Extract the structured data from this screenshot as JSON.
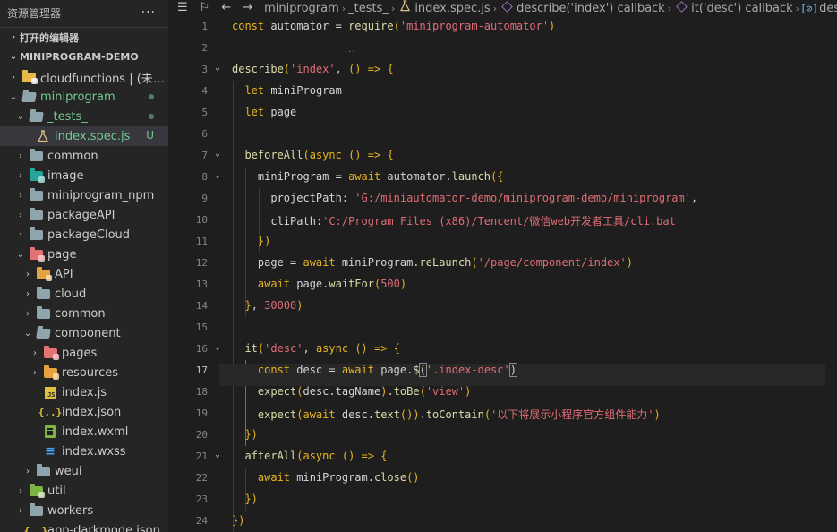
{
  "sidebar": {
    "title": "资源管理器",
    "more": "···",
    "open_editors": "打开的编辑器",
    "project": "MINIPROGRAM-DEMO",
    "tree": [
      {
        "label": "cloudfunctions | (未选...",
        "depth": 1,
        "chevron": "›",
        "icon": "folder-cloud",
        "color": "yellow-folder",
        "status": ""
      },
      {
        "label": "miniprogram",
        "depth": 1,
        "chevron": "⌄",
        "icon": "folder-open",
        "color": "green-label",
        "status": "dot"
      },
      {
        "label": "_tests_",
        "depth": 2,
        "chevron": "⌄",
        "icon": "folder-open",
        "color": "green-label",
        "status": "dot"
      },
      {
        "label": "index.spec.js",
        "depth": 3,
        "chevron": "",
        "icon": "flask",
        "color": "green-label",
        "status": "U",
        "selected": true
      },
      {
        "label": "common",
        "depth": 2,
        "chevron": "›",
        "icon": "folder",
        "color": "",
        "status": ""
      },
      {
        "label": "image",
        "depth": 2,
        "chevron": "›",
        "icon": "folder-image",
        "color": "",
        "status": ""
      },
      {
        "label": "miniprogram_npm",
        "depth": 2,
        "chevron": "›",
        "icon": "folder",
        "color": "",
        "status": ""
      },
      {
        "label": "packageAPI",
        "depth": 2,
        "chevron": "›",
        "icon": "folder",
        "color": "",
        "status": ""
      },
      {
        "label": "packageCloud",
        "depth": 2,
        "chevron": "›",
        "icon": "folder",
        "color": "",
        "status": ""
      },
      {
        "label": "page",
        "depth": 2,
        "chevron": "⌄",
        "icon": "folder-page",
        "color": "",
        "status": ""
      },
      {
        "label": "API",
        "depth": 3,
        "chevron": "›",
        "icon": "folder-api",
        "color": "",
        "status": ""
      },
      {
        "label": "cloud",
        "depth": 3,
        "chevron": "›",
        "icon": "folder",
        "color": "",
        "status": ""
      },
      {
        "label": "common",
        "depth": 3,
        "chevron": "›",
        "icon": "folder",
        "color": "",
        "status": ""
      },
      {
        "label": "component",
        "depth": 3,
        "chevron": "⌄",
        "icon": "folder-open",
        "color": "",
        "status": ""
      },
      {
        "label": "pages",
        "depth": 4,
        "chevron": "›",
        "icon": "folder-page",
        "color": "",
        "status": ""
      },
      {
        "label": "resources",
        "depth": 4,
        "chevron": "›",
        "icon": "folder-resources",
        "color": "",
        "status": ""
      },
      {
        "label": "index.js",
        "depth": 4,
        "chevron": "",
        "icon": "js",
        "color": "",
        "status": ""
      },
      {
        "label": "index.json",
        "depth": 4,
        "chevron": "",
        "icon": "json",
        "color": "",
        "status": ""
      },
      {
        "label": "index.wxml",
        "depth": 4,
        "chevron": "",
        "icon": "wxml",
        "color": "",
        "status": ""
      },
      {
        "label": "index.wxss",
        "depth": 4,
        "chevron": "",
        "icon": "wxss",
        "color": "",
        "status": ""
      },
      {
        "label": "weui",
        "depth": 3,
        "chevron": "›",
        "icon": "folder",
        "color": "",
        "status": ""
      },
      {
        "label": "util",
        "depth": 2,
        "chevron": "›",
        "icon": "folder-util",
        "color": "",
        "status": ""
      },
      {
        "label": "workers",
        "depth": 2,
        "chevron": "›",
        "icon": "folder",
        "color": "",
        "status": ""
      },
      {
        "label": "app-darkmode.json",
        "depth": 2,
        "chevron": "",
        "icon": "json",
        "color": "",
        "status": ""
      }
    ]
  },
  "breadcrumb": {
    "items": [
      {
        "label": "miniprogram",
        "icon": ""
      },
      {
        "label": "_tests_",
        "icon": ""
      },
      {
        "label": "index.spec.js",
        "icon": "flask"
      },
      {
        "label": "describe('index') callback",
        "icon": "cube"
      },
      {
        "label": "it('desc') callback",
        "icon": "cube"
      },
      {
        "label": "desc",
        "icon": "variable"
      }
    ]
  },
  "editor": {
    "current_line": 17,
    "lines": [
      {
        "n": "1",
        "fold": "",
        "tokens": [
          [
            "kw",
            "const"
          ],
          [
            "var",
            " automator "
          ],
          [
            "op",
            "= "
          ],
          [
            "fn",
            "require"
          ],
          [
            "pn",
            "("
          ],
          [
            "str",
            "'miniprogram-automator'"
          ],
          [
            "pn",
            ")"
          ]
        ]
      },
      {
        "n": "2",
        "fold": "",
        "tokens": []
      },
      {
        "n": "3",
        "fold": "⌄",
        "tokens": [
          [
            "fn",
            "describe"
          ],
          [
            "pn",
            "("
          ],
          [
            "str",
            "'index'"
          ],
          [
            "op",
            ", "
          ],
          [
            "pn",
            "() "
          ],
          [
            "kw",
            "=>"
          ],
          [
            "op",
            " "
          ],
          [
            "pn",
            "{"
          ]
        ]
      },
      {
        "n": "4",
        "fold": "",
        "tokens": [
          [
            "op",
            "  "
          ],
          [
            "kw",
            "let"
          ],
          [
            "var",
            " miniProgram"
          ]
        ]
      },
      {
        "n": "5",
        "fold": "",
        "tokens": [
          [
            "op",
            "  "
          ],
          [
            "kw",
            "let"
          ],
          [
            "var",
            " page"
          ]
        ]
      },
      {
        "n": "6",
        "fold": "",
        "tokens": []
      },
      {
        "n": "7",
        "fold": "⌄",
        "tokens": [
          [
            "op",
            "  "
          ],
          [
            "fn",
            "beforeAll"
          ],
          [
            "pn",
            "("
          ],
          [
            "kw",
            "async"
          ],
          [
            "op",
            " "
          ],
          [
            "pn",
            "() "
          ],
          [
            "kw",
            "=>"
          ],
          [
            "op",
            " "
          ],
          [
            "pn",
            "{"
          ]
        ]
      },
      {
        "n": "8",
        "fold": "⌄",
        "tokens": [
          [
            "op",
            "    "
          ],
          [
            "var",
            "miniProgram "
          ],
          [
            "op",
            "= "
          ],
          [
            "kw",
            "await"
          ],
          [
            "var",
            " automator."
          ],
          [
            "fn",
            "launch"
          ],
          [
            "pn",
            "({"
          ]
        ]
      },
      {
        "n": "9",
        "fold": "",
        "tokens": [
          [
            "op",
            "      "
          ],
          [
            "pr",
            "projectPath"
          ],
          [
            "op",
            ": "
          ],
          [
            "str",
            "'G:/miniautomator-demo/miniprogram-demo/miniprogram'"
          ],
          [
            "op",
            ","
          ]
        ]
      },
      {
        "n": "10",
        "fold": "",
        "tokens": [
          [
            "op",
            "      "
          ],
          [
            "pr",
            "cliPath"
          ],
          [
            "op",
            ":"
          ],
          [
            "str",
            "'C:/Program Files (x86)/Tencent/微信web开发者工具/cli.bat'"
          ]
        ]
      },
      {
        "n": "11",
        "fold": "",
        "tokens": [
          [
            "op",
            "    "
          ],
          [
            "pn",
            "})"
          ]
        ]
      },
      {
        "n": "12",
        "fold": "",
        "tokens": [
          [
            "op",
            "    "
          ],
          [
            "var",
            "page "
          ],
          [
            "op",
            "= "
          ],
          [
            "kw",
            "await"
          ],
          [
            "var",
            " miniProgram."
          ],
          [
            "fn",
            "reLaunch"
          ],
          [
            "pn",
            "("
          ],
          [
            "str",
            "'/page/component/index'"
          ],
          [
            "pn",
            ")"
          ]
        ]
      },
      {
        "n": "13",
        "fold": "",
        "tokens": [
          [
            "op",
            "    "
          ],
          [
            "kw",
            "await"
          ],
          [
            "var",
            " page."
          ],
          [
            "fn",
            "waitFor"
          ],
          [
            "pn",
            "("
          ],
          [
            "num",
            "500"
          ],
          [
            "pn",
            ")"
          ]
        ]
      },
      {
        "n": "14",
        "fold": "",
        "tokens": [
          [
            "op",
            "  "
          ],
          [
            "pn",
            "}"
          ],
          [
            "op",
            ", "
          ],
          [
            "num",
            "30000"
          ],
          [
            "pn",
            ")"
          ]
        ]
      },
      {
        "n": "15",
        "fold": "",
        "tokens": []
      },
      {
        "n": "16",
        "fold": "⌄",
        "tokens": [
          [
            "op",
            "  "
          ],
          [
            "fn",
            "it"
          ],
          [
            "pn",
            "("
          ],
          [
            "str",
            "'desc'"
          ],
          [
            "op",
            ", "
          ],
          [
            "kw",
            "async"
          ],
          [
            "op",
            " "
          ],
          [
            "pn",
            "() "
          ],
          [
            "kw",
            "=>"
          ],
          [
            "op",
            " "
          ],
          [
            "pn",
            "{"
          ]
        ]
      },
      {
        "n": "17",
        "fold": "",
        "tokens": [
          [
            "op",
            "    "
          ],
          [
            "kw",
            "const"
          ],
          [
            "var",
            " desc "
          ],
          [
            "op",
            "= "
          ],
          [
            "kw",
            "await"
          ],
          [
            "var",
            " page."
          ],
          [
            "fn",
            "$"
          ],
          [
            "bm",
            "("
          ],
          [
            "str",
            "'.index-desc'"
          ],
          [
            "bm",
            ")"
          ]
        ]
      },
      {
        "n": "18",
        "fold": "",
        "tokens": [
          [
            "op",
            "    "
          ],
          [
            "fn",
            "expect"
          ],
          [
            "pn",
            "("
          ],
          [
            "var",
            "desc.tagName"
          ],
          [
            "pn",
            ")"
          ],
          [
            "var",
            "."
          ],
          [
            "fn",
            "toBe"
          ],
          [
            "pn",
            "("
          ],
          [
            "str",
            "'view'"
          ],
          [
            "pn",
            ")"
          ]
        ]
      },
      {
        "n": "19",
        "fold": "",
        "tokens": [
          [
            "op",
            "    "
          ],
          [
            "fn",
            "expect"
          ],
          [
            "pn",
            "("
          ],
          [
            "kw",
            "await"
          ],
          [
            "var",
            " desc."
          ],
          [
            "fn",
            "text"
          ],
          [
            "pn",
            "())"
          ],
          [
            "var",
            "."
          ],
          [
            "fn",
            "toContain"
          ],
          [
            "pn",
            "("
          ],
          [
            "str",
            "'以下将展示小程序官方组件能力'"
          ],
          [
            "pn",
            ")"
          ]
        ]
      },
      {
        "n": "20",
        "fold": "",
        "tokens": [
          [
            "op",
            "  "
          ],
          [
            "pn",
            "})"
          ]
        ]
      },
      {
        "n": "21",
        "fold": "⌄",
        "tokens": [
          [
            "op",
            "  "
          ],
          [
            "fn",
            "afterAll"
          ],
          [
            "pn",
            "("
          ],
          [
            "kw",
            "async"
          ],
          [
            "op",
            " "
          ],
          [
            "pn",
            "() "
          ],
          [
            "kw",
            "=>"
          ],
          [
            "op",
            " "
          ],
          [
            "pn",
            "{"
          ]
        ]
      },
      {
        "n": "22",
        "fold": "",
        "tokens": [
          [
            "op",
            "    "
          ],
          [
            "kw",
            "await"
          ],
          [
            "var",
            " miniProgram."
          ],
          [
            "fn",
            "close"
          ],
          [
            "pn",
            "()"
          ]
        ]
      },
      {
        "n": "23",
        "fold": "",
        "tokens": [
          [
            "op",
            "  "
          ],
          [
            "pn",
            "})"
          ]
        ]
      },
      {
        "n": "24",
        "fold": "",
        "tokens": [
          [
            "pn",
            "})"
          ]
        ]
      }
    ]
  },
  "colors": {
    "editor_bg": "#1e1e1e",
    "sidebar_bg": "#252526",
    "selected_row": "#37373d",
    "git_added": "#73c991"
  }
}
